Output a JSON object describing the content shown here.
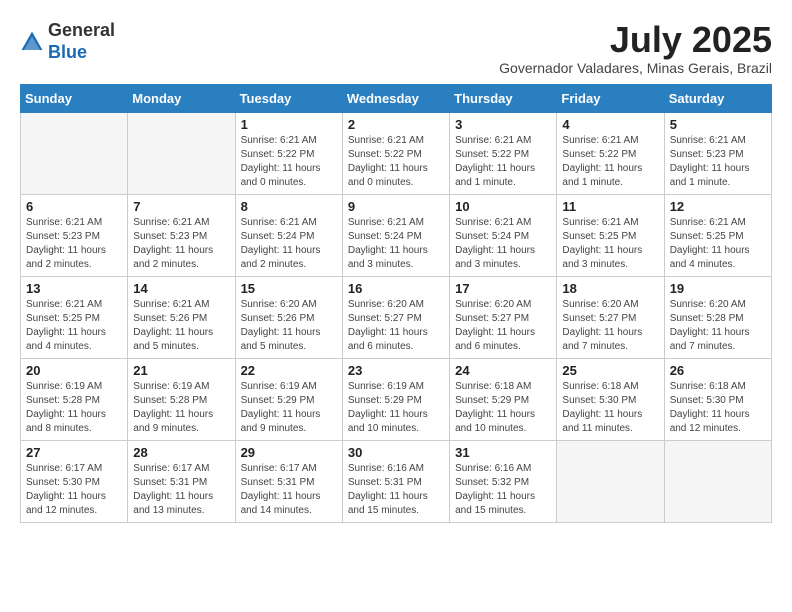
{
  "header": {
    "logo_general": "General",
    "logo_blue": "Blue",
    "month_title": "July 2025",
    "location": "Governador Valadares, Minas Gerais, Brazil"
  },
  "days_of_week": [
    "Sunday",
    "Monday",
    "Tuesday",
    "Wednesday",
    "Thursday",
    "Friday",
    "Saturday"
  ],
  "weeks": [
    [
      {
        "day": "",
        "info": ""
      },
      {
        "day": "",
        "info": ""
      },
      {
        "day": "1",
        "info": "Sunrise: 6:21 AM\nSunset: 5:22 PM\nDaylight: 11 hours and 0 minutes."
      },
      {
        "day": "2",
        "info": "Sunrise: 6:21 AM\nSunset: 5:22 PM\nDaylight: 11 hours and 0 minutes."
      },
      {
        "day": "3",
        "info": "Sunrise: 6:21 AM\nSunset: 5:22 PM\nDaylight: 11 hours and 1 minute."
      },
      {
        "day": "4",
        "info": "Sunrise: 6:21 AM\nSunset: 5:22 PM\nDaylight: 11 hours and 1 minute."
      },
      {
        "day": "5",
        "info": "Sunrise: 6:21 AM\nSunset: 5:23 PM\nDaylight: 11 hours and 1 minute."
      }
    ],
    [
      {
        "day": "6",
        "info": "Sunrise: 6:21 AM\nSunset: 5:23 PM\nDaylight: 11 hours and 2 minutes."
      },
      {
        "day": "7",
        "info": "Sunrise: 6:21 AM\nSunset: 5:23 PM\nDaylight: 11 hours and 2 minutes."
      },
      {
        "day": "8",
        "info": "Sunrise: 6:21 AM\nSunset: 5:24 PM\nDaylight: 11 hours and 2 minutes."
      },
      {
        "day": "9",
        "info": "Sunrise: 6:21 AM\nSunset: 5:24 PM\nDaylight: 11 hours and 3 minutes."
      },
      {
        "day": "10",
        "info": "Sunrise: 6:21 AM\nSunset: 5:24 PM\nDaylight: 11 hours and 3 minutes."
      },
      {
        "day": "11",
        "info": "Sunrise: 6:21 AM\nSunset: 5:25 PM\nDaylight: 11 hours and 3 minutes."
      },
      {
        "day": "12",
        "info": "Sunrise: 6:21 AM\nSunset: 5:25 PM\nDaylight: 11 hours and 4 minutes."
      }
    ],
    [
      {
        "day": "13",
        "info": "Sunrise: 6:21 AM\nSunset: 5:25 PM\nDaylight: 11 hours and 4 minutes."
      },
      {
        "day": "14",
        "info": "Sunrise: 6:21 AM\nSunset: 5:26 PM\nDaylight: 11 hours and 5 minutes."
      },
      {
        "day": "15",
        "info": "Sunrise: 6:20 AM\nSunset: 5:26 PM\nDaylight: 11 hours and 5 minutes."
      },
      {
        "day": "16",
        "info": "Sunrise: 6:20 AM\nSunset: 5:27 PM\nDaylight: 11 hours and 6 minutes."
      },
      {
        "day": "17",
        "info": "Sunrise: 6:20 AM\nSunset: 5:27 PM\nDaylight: 11 hours and 6 minutes."
      },
      {
        "day": "18",
        "info": "Sunrise: 6:20 AM\nSunset: 5:27 PM\nDaylight: 11 hours and 7 minutes."
      },
      {
        "day": "19",
        "info": "Sunrise: 6:20 AM\nSunset: 5:28 PM\nDaylight: 11 hours and 7 minutes."
      }
    ],
    [
      {
        "day": "20",
        "info": "Sunrise: 6:19 AM\nSunset: 5:28 PM\nDaylight: 11 hours and 8 minutes."
      },
      {
        "day": "21",
        "info": "Sunrise: 6:19 AM\nSunset: 5:28 PM\nDaylight: 11 hours and 9 minutes."
      },
      {
        "day": "22",
        "info": "Sunrise: 6:19 AM\nSunset: 5:29 PM\nDaylight: 11 hours and 9 minutes."
      },
      {
        "day": "23",
        "info": "Sunrise: 6:19 AM\nSunset: 5:29 PM\nDaylight: 11 hours and 10 minutes."
      },
      {
        "day": "24",
        "info": "Sunrise: 6:18 AM\nSunset: 5:29 PM\nDaylight: 11 hours and 10 minutes."
      },
      {
        "day": "25",
        "info": "Sunrise: 6:18 AM\nSunset: 5:30 PM\nDaylight: 11 hours and 11 minutes."
      },
      {
        "day": "26",
        "info": "Sunrise: 6:18 AM\nSunset: 5:30 PM\nDaylight: 11 hours and 12 minutes."
      }
    ],
    [
      {
        "day": "27",
        "info": "Sunrise: 6:17 AM\nSunset: 5:30 PM\nDaylight: 11 hours and 12 minutes."
      },
      {
        "day": "28",
        "info": "Sunrise: 6:17 AM\nSunset: 5:31 PM\nDaylight: 11 hours and 13 minutes."
      },
      {
        "day": "29",
        "info": "Sunrise: 6:17 AM\nSunset: 5:31 PM\nDaylight: 11 hours and 14 minutes."
      },
      {
        "day": "30",
        "info": "Sunrise: 6:16 AM\nSunset: 5:31 PM\nDaylight: 11 hours and 15 minutes."
      },
      {
        "day": "31",
        "info": "Sunrise: 6:16 AM\nSunset: 5:32 PM\nDaylight: 11 hours and 15 minutes."
      },
      {
        "day": "",
        "info": ""
      },
      {
        "day": "",
        "info": ""
      }
    ]
  ]
}
